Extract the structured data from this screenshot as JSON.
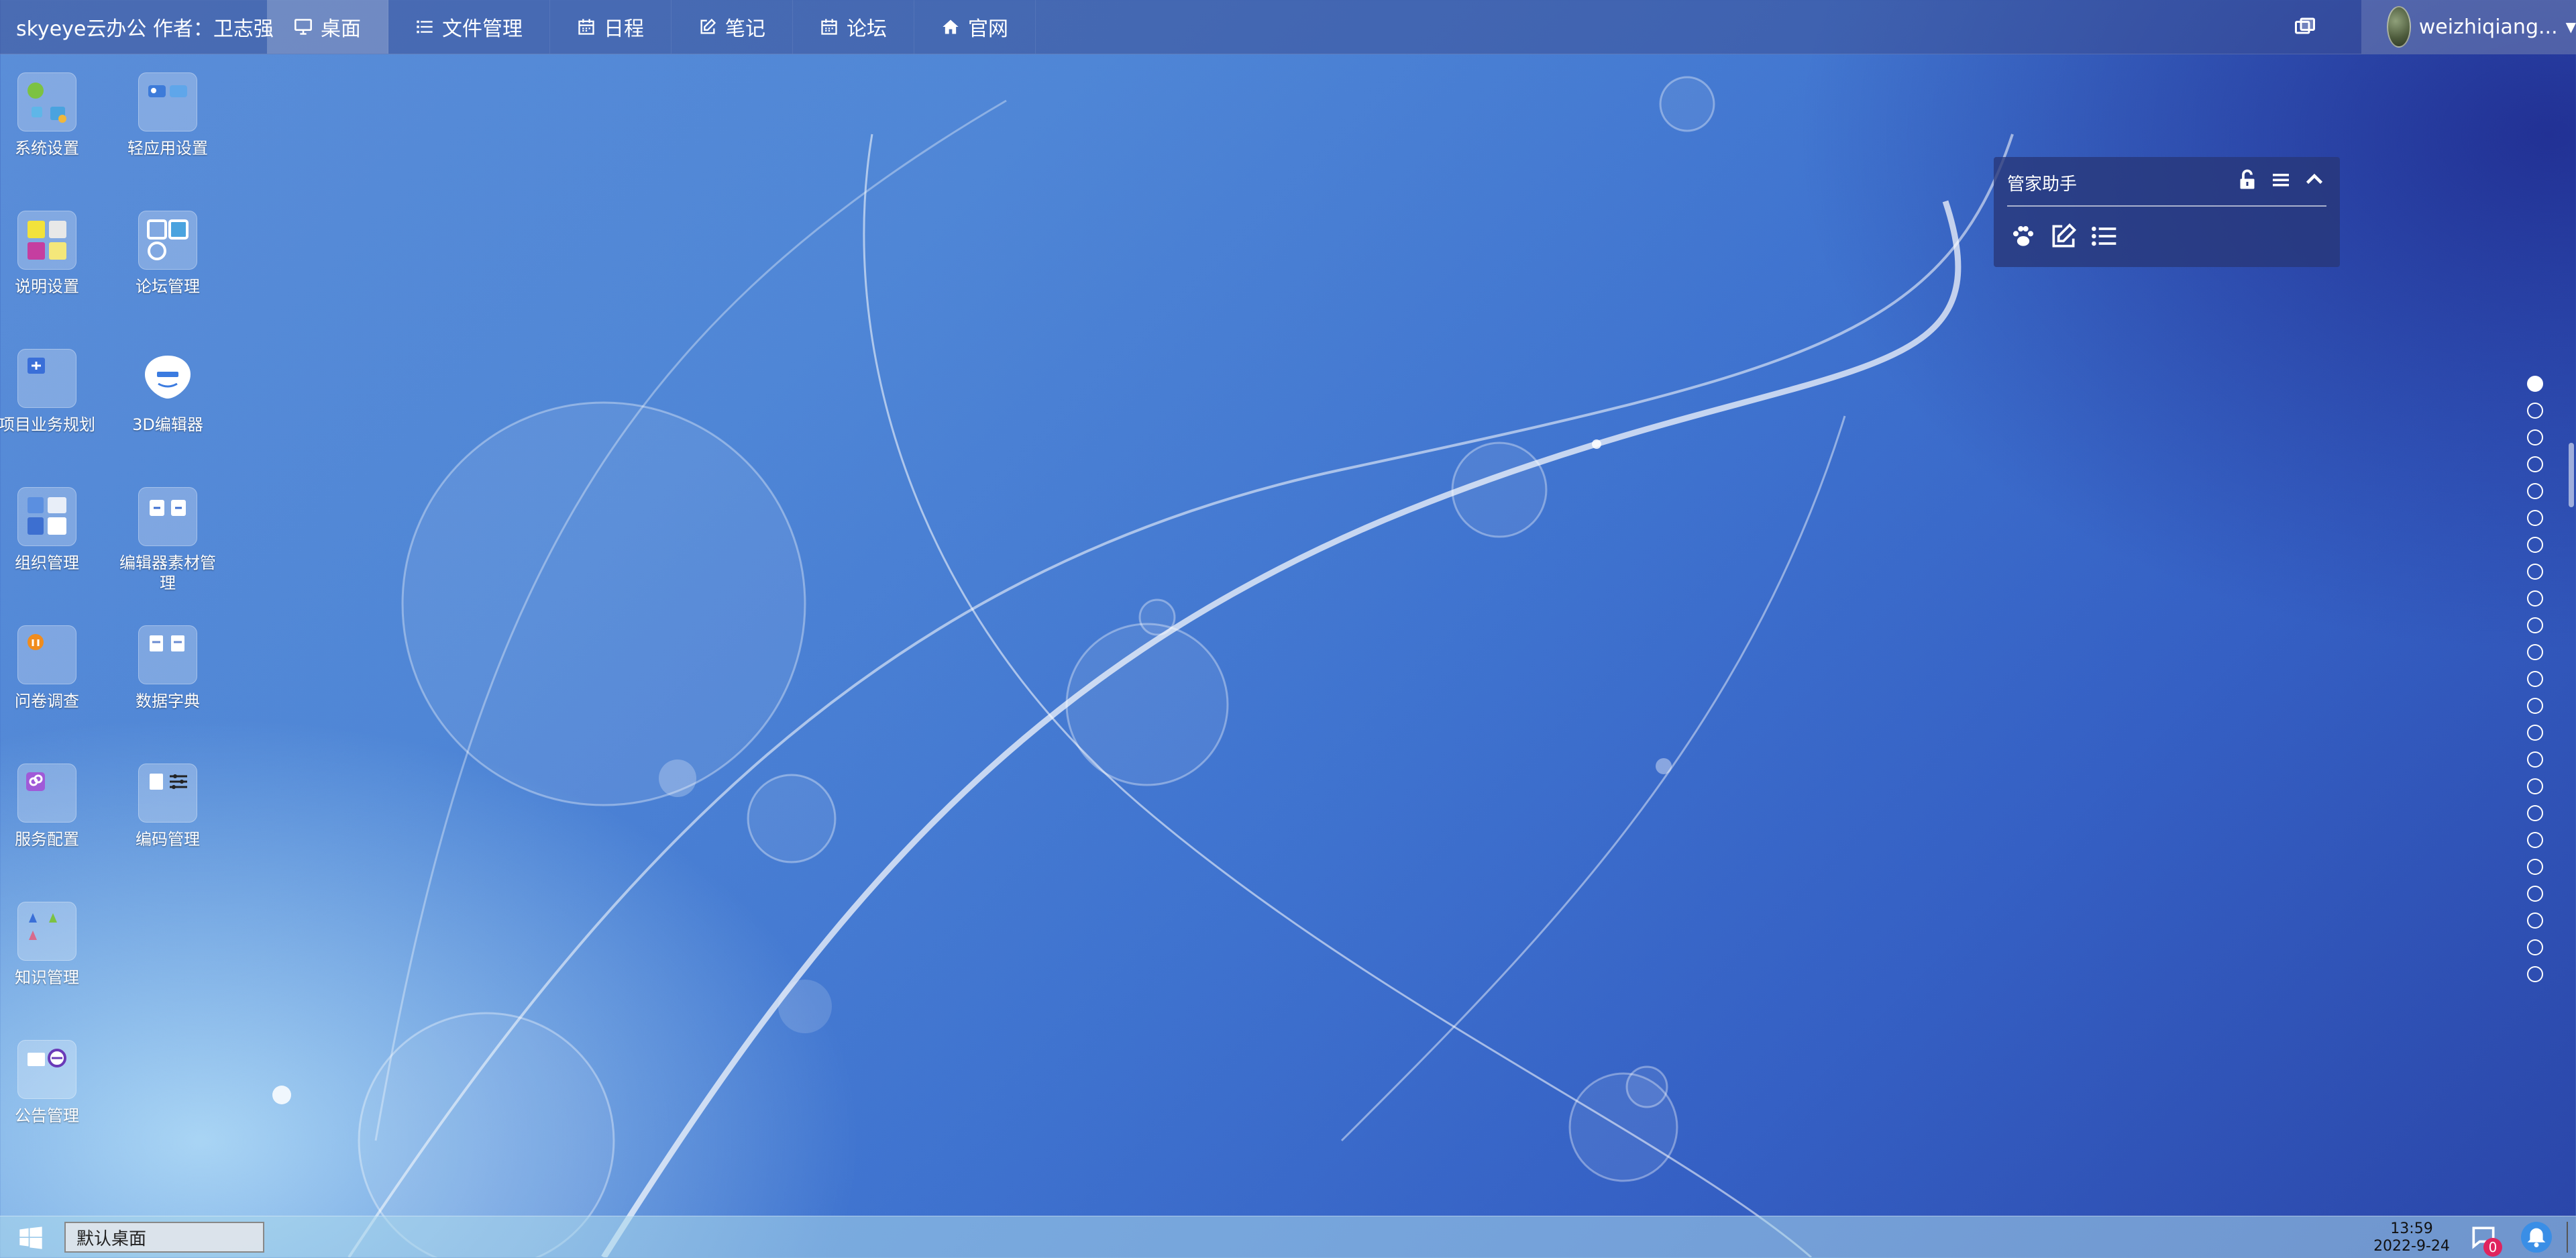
{
  "topbar": {
    "brand": "skyeye云办公 作者：卫志强",
    "nav": [
      {
        "label": "桌面",
        "icon": "monitor-icon",
        "active": true
      },
      {
        "label": "文件管理",
        "icon": "list-icon",
        "active": false
      },
      {
        "label": "日程",
        "icon": "calendar-icon",
        "active": false
      },
      {
        "label": "笔记",
        "icon": "edit-icon",
        "active": false
      },
      {
        "label": "论坛",
        "icon": "calendar-icon",
        "active": false
      },
      {
        "label": "官网",
        "icon": "home-icon",
        "active": false
      }
    ],
    "user": {
      "name": "weizhiqiang...",
      "avatar": "user-avatar"
    }
  },
  "desktop": {
    "icons": [
      {
        "label": "系统设置"
      },
      {
        "label": "轻应用设置"
      },
      {
        "label": "说明设置"
      },
      {
        "label": "论坛管理"
      },
      {
        "label": "项目业务规划"
      },
      {
        "label": "3D编辑器"
      },
      {
        "label": "组织管理"
      },
      {
        "label": "编辑器素材管理"
      },
      {
        "label": "问卷调查"
      },
      {
        "label": "数据字典"
      },
      {
        "label": "服务配置"
      },
      {
        "label": "编码管理"
      },
      {
        "label": "知识管理"
      },
      {
        "label": "公告管理"
      }
    ]
  },
  "assistant": {
    "title": "管家助手",
    "controls": [
      "unlock-icon",
      "menu-icon",
      "chevron-up-icon"
    ],
    "tools": [
      "paw-icon",
      "edit-icon",
      "list-icon"
    ]
  },
  "pager": {
    "total": 23,
    "active_index": 0
  },
  "taskbar": {
    "task": "默认桌面",
    "time": "13:59",
    "date": "2022-9-24",
    "chat_badge": "0"
  },
  "colors": {
    "accent": "#3a8ee6",
    "badge": "#e0245e",
    "panel": "#28377a"
  }
}
